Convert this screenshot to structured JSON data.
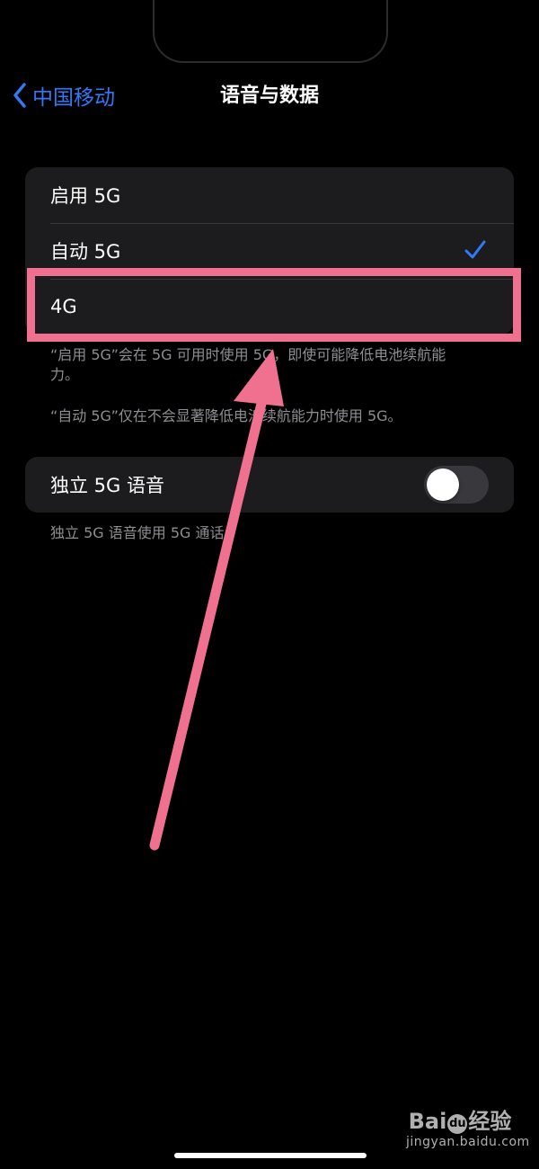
{
  "nav": {
    "back_label": "中国移动",
    "title": "语音与数据"
  },
  "voice_data_options": {
    "items": [
      {
        "label": "启用 5G",
        "selected": false
      },
      {
        "label": "自动 5G",
        "selected": true
      },
      {
        "label": "4G",
        "selected": false
      }
    ],
    "note_1": "“启用 5G”会在 5G 可用时使用 5G，即使可能降低电池续航能力。",
    "note_2": "“自动 5G”仅在不会显著降低电池续航能力时使用 5G。"
  },
  "standalone": {
    "label": "独立 5G 语音",
    "enabled": false,
    "note": "独立 5G 语音使用 5G 通话。"
  },
  "colors": {
    "accent": "#3478f6",
    "annotation": "#f0718f",
    "cell_background": "#1c1c1e",
    "secondary_text": "#8e8e93"
  },
  "icons": {
    "back": "chevron-left-icon",
    "selected": "checkmark-icon",
    "annotation_arrow": "arrow-icon"
  },
  "watermark": {
    "logo_left": "Bai",
    "logo_paw": "du",
    "logo_right": "经验",
    "site": "jingyan.baidu.com"
  }
}
